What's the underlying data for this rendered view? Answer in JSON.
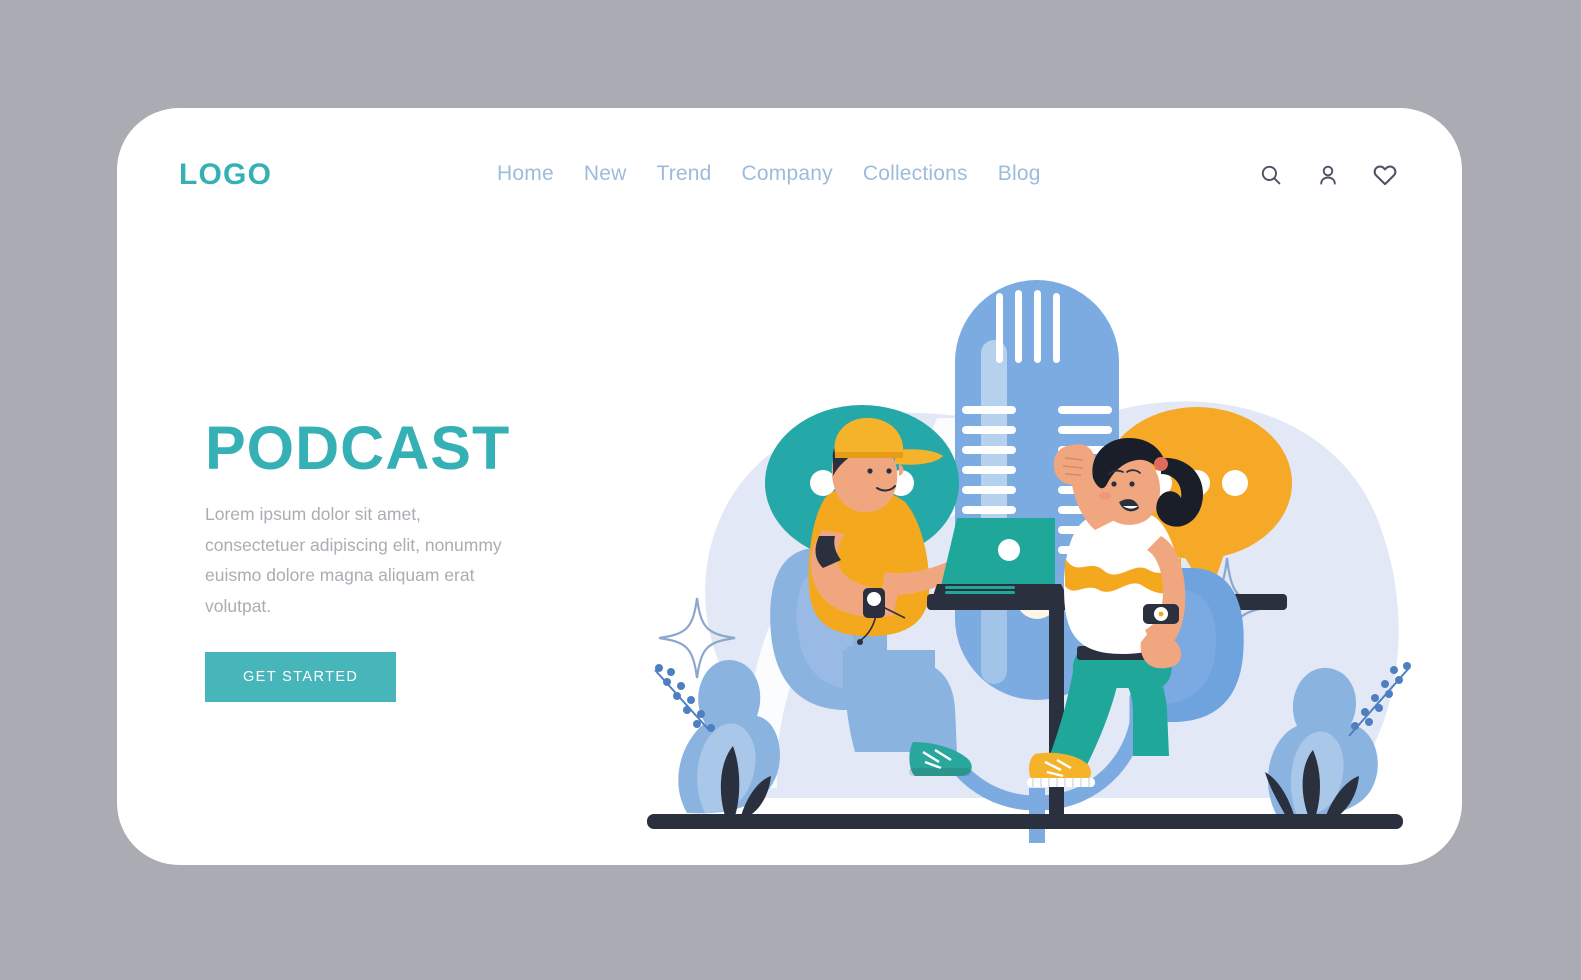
{
  "page": {
    "background_color": "#aaabb3",
    "card_color": "#ffffff"
  },
  "header": {
    "logo": "LOGO",
    "nav": [
      {
        "label": "Home"
      },
      {
        "label": "New"
      },
      {
        "label": "Trend"
      },
      {
        "label": "Company"
      },
      {
        "label": "Collections"
      },
      {
        "label": "Blog"
      }
    ],
    "icons": [
      {
        "name": "search-icon"
      },
      {
        "name": "user-icon"
      },
      {
        "name": "heart-icon"
      }
    ]
  },
  "hero": {
    "title": "PODCAST",
    "paragraph": "Lorem ipsum dolor sit amet, consectetuer adipiscing elit, nonummy euismo dolore magna aliquam erat volutpat.",
    "cta_label": "GET STARTED"
  },
  "colors": {
    "brand_teal": "#35b1b6",
    "button_teal": "#46b6bb",
    "nav_blue": "#9dbcdb",
    "body_gray": "#a9adb4",
    "mic_blue": "#7babe0",
    "bubble_teal": "#24a8a8",
    "bubble_orange": "#f6a926",
    "blob_lavender": "#e2e8f5",
    "dark_navy": "#2b303e",
    "shirt_yellow": "#f4a81d",
    "pants_teal": "#1fa79a",
    "jeans_blue": "#8cb1e0",
    "skin": "#f0a780",
    "plant_blue": "#8ab3e0"
  },
  "illustration": {
    "name": "podcast-recording-scene",
    "elements": [
      "background-blob",
      "microphone",
      "teal-speech-bubble",
      "orange-speech-bubble",
      "sparkle-star-left",
      "sparkle-star-top",
      "sparkle-star-right",
      "man-with-laptop",
      "woman-waving",
      "table",
      "chair-left",
      "chair-right",
      "plant-left",
      "plant-right",
      "ground-line"
    ]
  }
}
